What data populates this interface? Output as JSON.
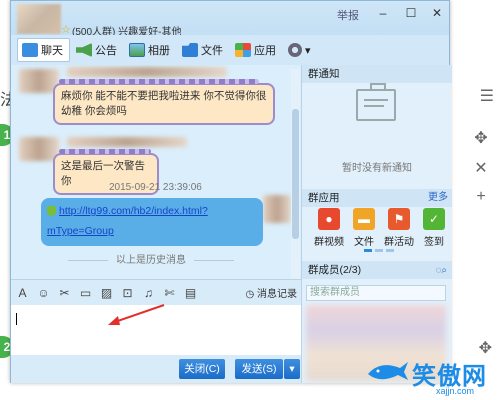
{
  "page": {
    "left_partial_text": "法",
    "step_numbers": [
      "1",
      "2"
    ],
    "right_icons": [
      "move-icon",
      "close-icon",
      "add-icon",
      "move-icon"
    ]
  },
  "window": {
    "group_star": "☆",
    "group_name": "(500人群) 兴趣爱好-其他",
    "report_label": "举报",
    "controls": {
      "minimize": "–",
      "maximize": "☐",
      "close": "✕"
    }
  },
  "toolbar": {
    "tabs": [
      {
        "label": "聊天",
        "icon": "chat-icon",
        "active": true
      },
      {
        "label": "公告",
        "icon": "notice-icon",
        "active": false
      },
      {
        "label": "相册",
        "icon": "album-icon",
        "active": false
      },
      {
        "label": "文件",
        "icon": "folder-icon",
        "active": false
      },
      {
        "label": "应用",
        "icon": "apps-icon",
        "active": false
      }
    ],
    "settings_icon": "gear-icon",
    "dropdown": "▾"
  },
  "chat": {
    "messages": [
      {
        "text": "麻烦你  能不能不要把我啦进来  你不觉得你很幼稚  你会烦吗"
      },
      {
        "text": "这是最后一次警告你"
      }
    ],
    "timestamp": "2015-09-21  23:39:06",
    "link_message": {
      "line1": "http://ltg99.com/hb2/index.html?",
      "line2": "mType=Group"
    },
    "history_label": "以上是历史消息"
  },
  "edit_bar": {
    "tools": [
      "A",
      "☺",
      "✂",
      "▭",
      "▨",
      "⊡",
      "♫",
      "✄",
      "▤"
    ],
    "message_record": "消息记录"
  },
  "input": {
    "value": ""
  },
  "actions": {
    "close_label": "关闭(C)",
    "send_label": "发送(S)",
    "send_dropdown": "▾"
  },
  "right_panel": {
    "notice_title": "群通知",
    "no_notice": "暂时没有新通知",
    "apps_title": "群应用",
    "more_label": "更多",
    "apps": [
      {
        "label": "群视频",
        "color": "#e8482d"
      },
      {
        "label": "文件",
        "color": "#f0a526"
      },
      {
        "label": "群活动",
        "color": "#e85a2d"
      },
      {
        "label": "签到",
        "color": "#53b535"
      }
    ],
    "members_title": "群成员(2/3)",
    "member_search_placeholder": "搜索群成员"
  },
  "watermark": {
    "text": "笑傲网",
    "url": "xajjn.com"
  }
}
